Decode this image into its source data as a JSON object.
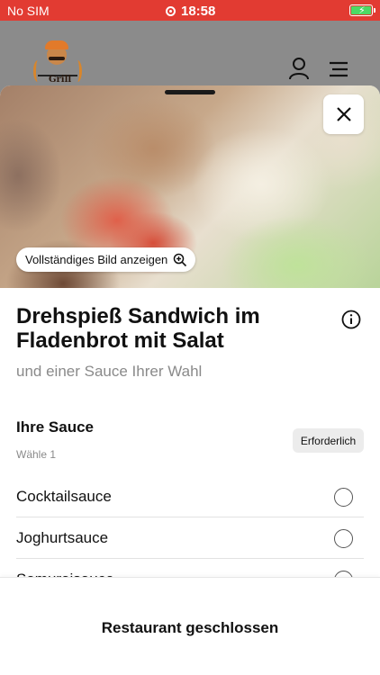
{
  "status_bar": {
    "carrier": "No SIM",
    "time": "18:58"
  },
  "header": {
    "logo_text": "Grill"
  },
  "modal": {
    "view_full_image_label": "Vollständiges Bild anzeigen",
    "title": "Drehspieß Sandwich im Fladenbrot mit Salat",
    "subtitle": "und einer Sauce Ihrer Wahl",
    "section": {
      "title": "Ihre Sauce",
      "hint": "Wähle 1",
      "badge": "Erforderlich",
      "options": [
        {
          "label": "Cocktailsauce"
        },
        {
          "label": "Joghurtsauce"
        },
        {
          "label": "Samuraisauce"
        }
      ]
    }
  },
  "footer": {
    "status_label": "Restaurant geschlossen"
  },
  "colors": {
    "status_bar": "#e23b32",
    "header": "#8b8b8b",
    "battery": "#4cd964"
  }
}
